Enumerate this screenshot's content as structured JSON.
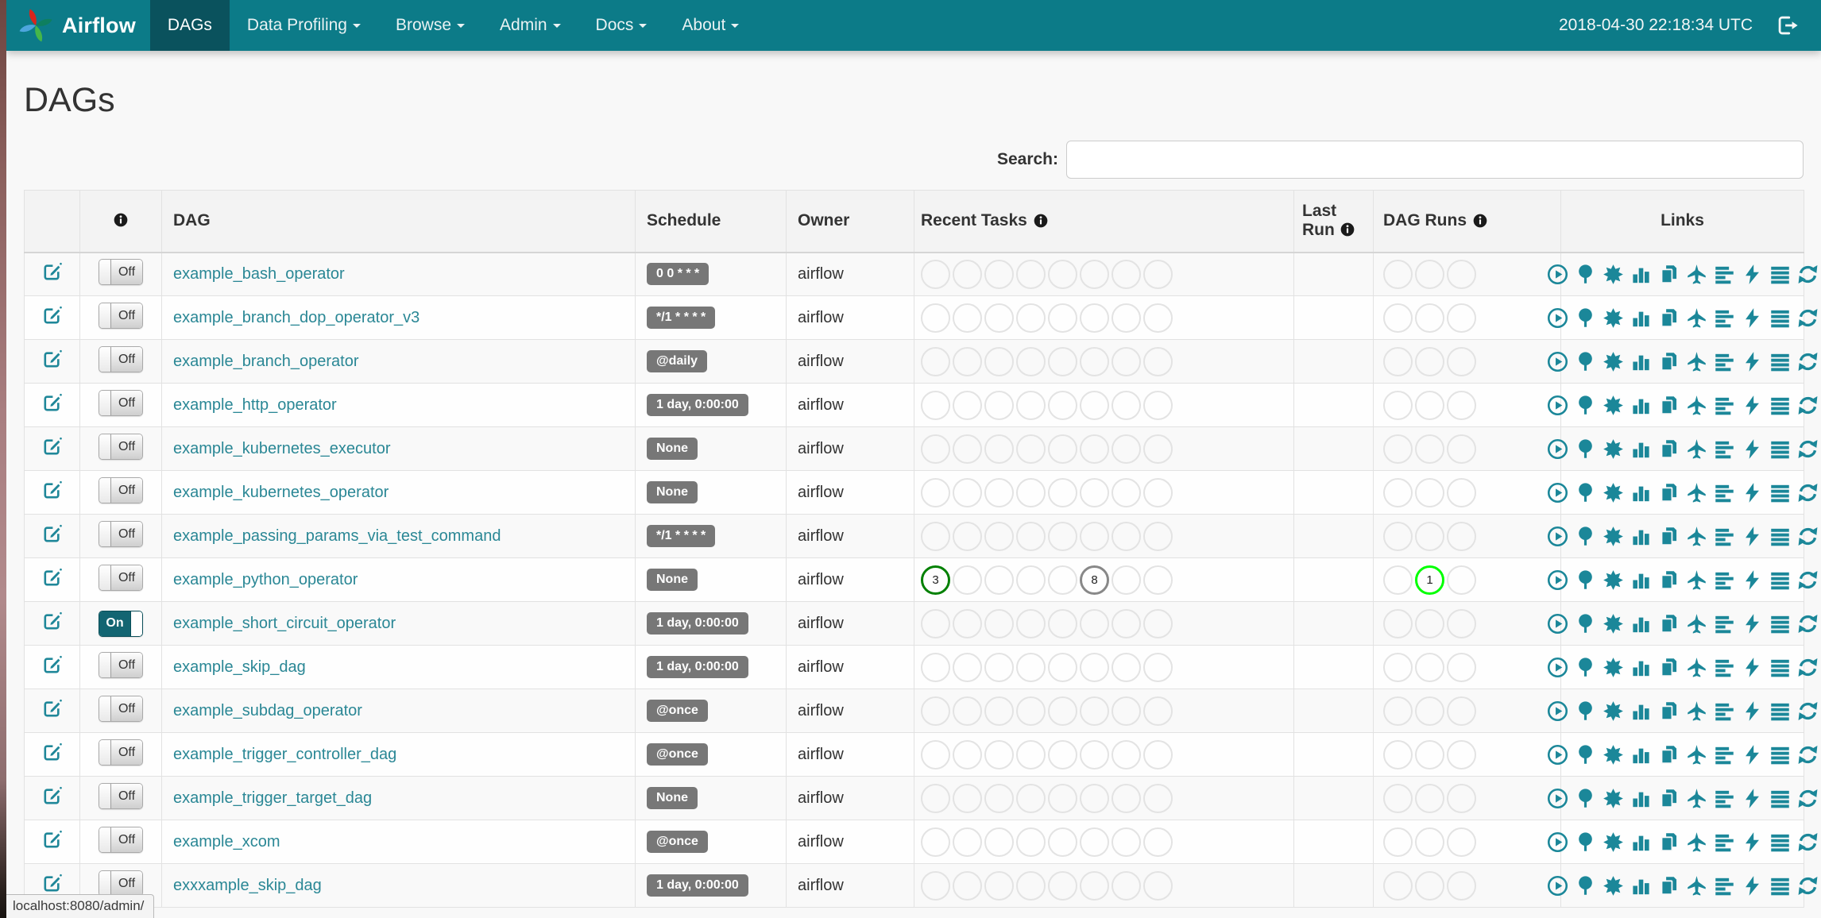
{
  "navbar": {
    "brand": "Airflow",
    "items": [
      {
        "label": "DAGs",
        "active": true,
        "caret": false
      },
      {
        "label": "Data Profiling",
        "active": false,
        "caret": true
      },
      {
        "label": "Browse",
        "active": false,
        "caret": true
      },
      {
        "label": "Admin",
        "active": false,
        "caret": true
      },
      {
        "label": "Docs",
        "active": false,
        "caret": true
      },
      {
        "label": "About",
        "active": false,
        "caret": true
      }
    ],
    "clock": "2018-04-30 22:18:34 UTC",
    "logout_icon": "sign-out-icon"
  },
  "page": {
    "title": "DAGs",
    "search_label": "Search:",
    "search_value": ""
  },
  "table": {
    "headers": {
      "toggle_info_icon": "info-icon",
      "dag": "DAG",
      "schedule": "Schedule",
      "owner": "Owner",
      "recent_tasks": "Recent Tasks",
      "last_run": "Last Run",
      "dag_runs": "DAG Runs",
      "links": "Links"
    },
    "recent_tasks_slots": 8,
    "dag_runs_slots": 3,
    "link_icons": [
      "trigger-dag-icon",
      "tree-view-icon",
      "graph-view-icon",
      "task-duration-icon",
      "task-tries-icon",
      "landing-times-icon",
      "gantt-icon",
      "code-icon",
      "logs-icon",
      "refresh-icon"
    ],
    "rows": [
      {
        "toggle": "Off",
        "name": "example_bash_operator",
        "schedule": "0 0 * * *",
        "owner": "airflow",
        "last_run": "",
        "recent_tasks": [],
        "dag_runs": []
      },
      {
        "toggle": "Off",
        "name": "example_branch_dop_operator_v3",
        "schedule": "*/1 * * * *",
        "owner": "airflow",
        "last_run": "",
        "recent_tasks": [],
        "dag_runs": []
      },
      {
        "toggle": "Off",
        "name": "example_branch_operator",
        "schedule": "@daily",
        "owner": "airflow",
        "last_run": "",
        "recent_tasks": [],
        "dag_runs": []
      },
      {
        "toggle": "Off",
        "name": "example_http_operator",
        "schedule": "1 day, 0:00:00",
        "owner": "airflow",
        "last_run": "",
        "recent_tasks": [],
        "dag_runs": []
      },
      {
        "toggle": "Off",
        "name": "example_kubernetes_executor",
        "schedule": "None",
        "owner": "airflow",
        "last_run": "",
        "recent_tasks": [],
        "dag_runs": []
      },
      {
        "toggle": "Off",
        "name": "example_kubernetes_operator",
        "schedule": "None",
        "owner": "airflow",
        "last_run": "",
        "recent_tasks": [],
        "dag_runs": []
      },
      {
        "toggle": "Off",
        "name": "example_passing_params_via_test_command",
        "schedule": "*/1 * * * *",
        "owner": "airflow",
        "last_run": "",
        "recent_tasks": [],
        "dag_runs": []
      },
      {
        "toggle": "Off",
        "name": "example_python_operator",
        "schedule": "None",
        "owner": "airflow",
        "last_run": "",
        "recent_tasks": [
          {
            "slot": 0,
            "count": 3,
            "state": "success"
          },
          {
            "slot": 5,
            "count": 8,
            "state": "no_status"
          }
        ],
        "dag_runs": [
          {
            "slot": 1,
            "count": 1,
            "state": "running"
          }
        ]
      },
      {
        "toggle": "On",
        "name": "example_short_circuit_operator",
        "schedule": "1 day, 0:00:00",
        "owner": "airflow",
        "last_run": "",
        "recent_tasks": [],
        "dag_runs": []
      },
      {
        "toggle": "Off",
        "name": "example_skip_dag",
        "schedule": "1 day, 0:00:00",
        "owner": "airflow",
        "last_run": "",
        "recent_tasks": [],
        "dag_runs": []
      },
      {
        "toggle": "Off",
        "name": "example_subdag_operator",
        "schedule": "@once",
        "owner": "airflow",
        "last_run": "",
        "recent_tasks": [],
        "dag_runs": []
      },
      {
        "toggle": "Off",
        "name": "example_trigger_controller_dag",
        "schedule": "@once",
        "owner": "airflow",
        "last_run": "",
        "recent_tasks": [],
        "dag_runs": []
      },
      {
        "toggle": "Off",
        "name": "example_trigger_target_dag",
        "schedule": "None",
        "owner": "airflow",
        "last_run": "",
        "recent_tasks": [],
        "dag_runs": []
      },
      {
        "toggle": "Off",
        "name": "example_xcom",
        "schedule": "@once",
        "owner": "airflow",
        "last_run": "",
        "recent_tasks": [],
        "dag_runs": []
      },
      {
        "toggle": "Off",
        "name": "exxxample_skip_dag",
        "schedule": "1 day, 0:00:00",
        "owner": "airflow",
        "last_run": "",
        "recent_tasks": [],
        "dag_runs": []
      }
    ]
  },
  "statusbar": {
    "url": "localhost:8080/admin/"
  },
  "colors": {
    "navbar_bg": "#0c7b88",
    "navbar_active_bg": "#0a525d",
    "accent_teal": "#1f8799",
    "badge_bg": "#777777",
    "states": {
      "success": "#008000",
      "running": "#00ff00",
      "no_status": "#888888"
    }
  }
}
